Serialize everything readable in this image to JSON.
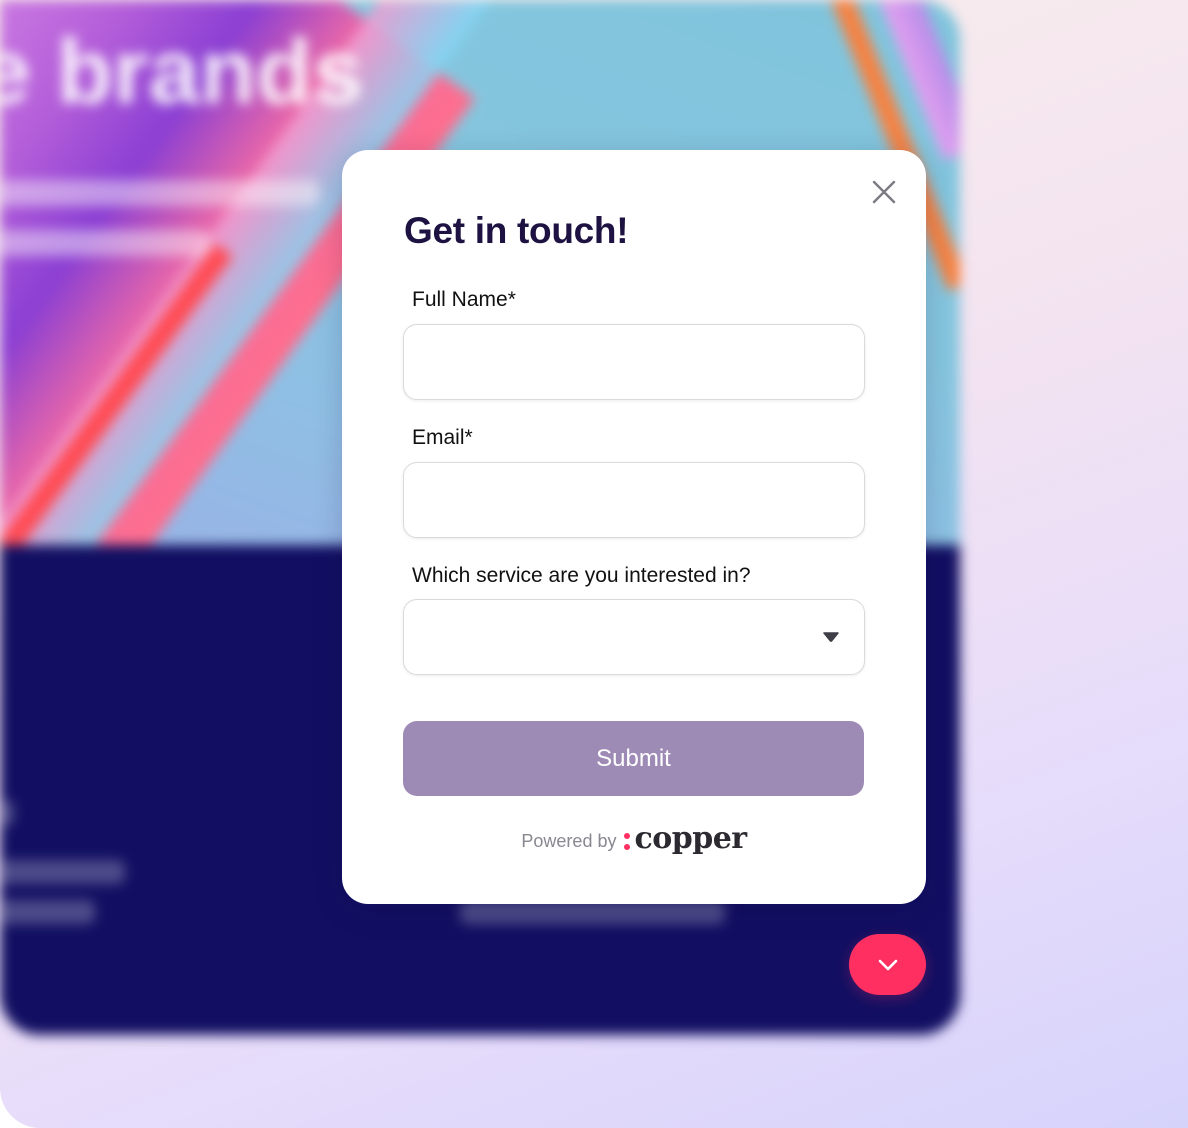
{
  "background": {
    "hero_title": "e brands"
  },
  "modal": {
    "title": "Get in touch!",
    "fields": {
      "full_name": {
        "label": "Full Name*",
        "value": "",
        "placeholder": ""
      },
      "email": {
        "label": "Email*",
        "value": "",
        "placeholder": ""
      },
      "service": {
        "label": "Which service are you interested in?",
        "selected": ""
      }
    },
    "submit_label": "Submit",
    "powered_by": "Powered by",
    "brand": "copper",
    "close_icon": "close-icon",
    "dropdown_icon": "caret-down-icon"
  },
  "launcher": {
    "icon": "chevron-down-icon"
  },
  "colors": {
    "title": "#1d1242",
    "submit": "#9d8bb6",
    "launcher": "#ff2f62",
    "brand_dot_top": "#ff2f62",
    "brand_dot_bottom": "#6a4bd8",
    "footer_bg": "#120f62"
  }
}
